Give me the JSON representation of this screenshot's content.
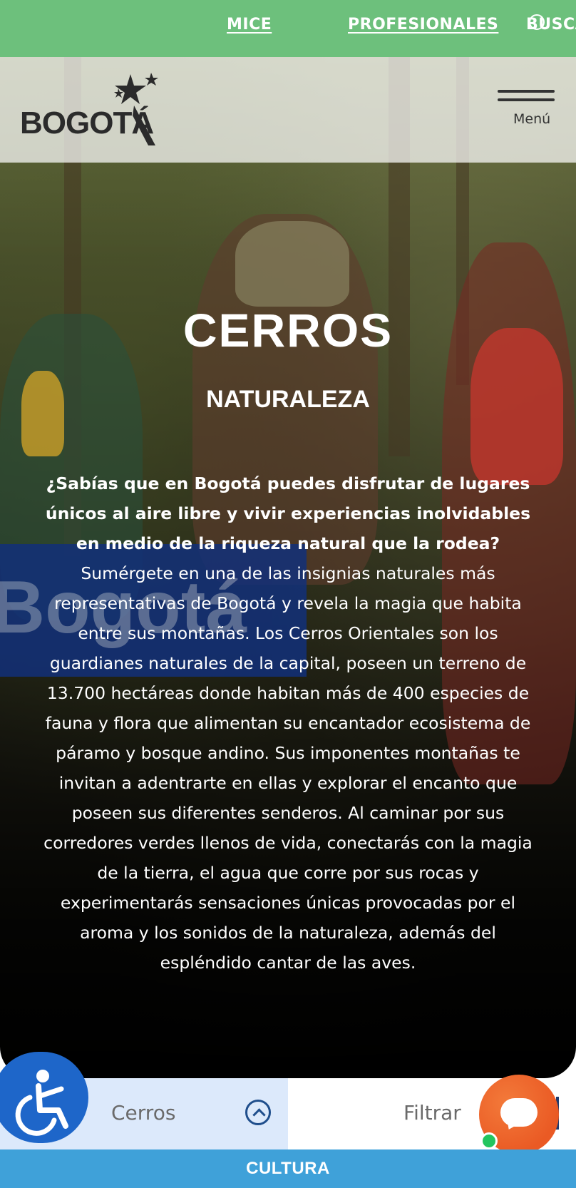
{
  "topbar": {
    "links": [
      "MICE",
      "PROFESIONALES"
    ],
    "search_label": "BUSCAR"
  },
  "header": {
    "logo_text": "BOGOTÁ",
    "menu_label": "Menú"
  },
  "hero": {
    "title": "CERROS",
    "subtitle": "NATURALEZA",
    "lead": "¿Sabías que en Bogotá puedes disfrutar de lugares únicos al aire libre y vivir experiencias inolvidables en medio de la riqueza natural que la rodea?",
    "body": "Sumérgete en una de las insignias naturales más representativas de Bogotá y revela la magia que habita entre sus montañas. Los Cerros Orientales son los guardianes naturales de la capital, poseen un terreno de 13.700 hectáreas donde habitan más de 400 especies de fauna y flora que alimentan su encantador ecosistema de páramo y bosque andino. Sus imponentes montañas te invitan a adentrarte en ellas y explorar el encanto que poseen sus diferentes senderos. Al caminar por sus corredores verdes llenos de vida, conectarás con la magia de la tierra, el agua que corre por sus rocas y experimentarás sensaciones únicas provocadas por el aroma y los sonidos de la naturaleza, además del espléndido cantar de las aves.",
    "background_banner_text": "Bogotá"
  },
  "filter": {
    "selected": "Cerros",
    "filter_label": "Filtrar"
  },
  "footer": {
    "category": "CULTURA"
  },
  "colors": {
    "topbar": "#6dc07c",
    "accessibility": "#1e66c9",
    "chat": "#ea5a24",
    "cultura": "#3fa1d9",
    "filter_left": "#dce9fb"
  }
}
